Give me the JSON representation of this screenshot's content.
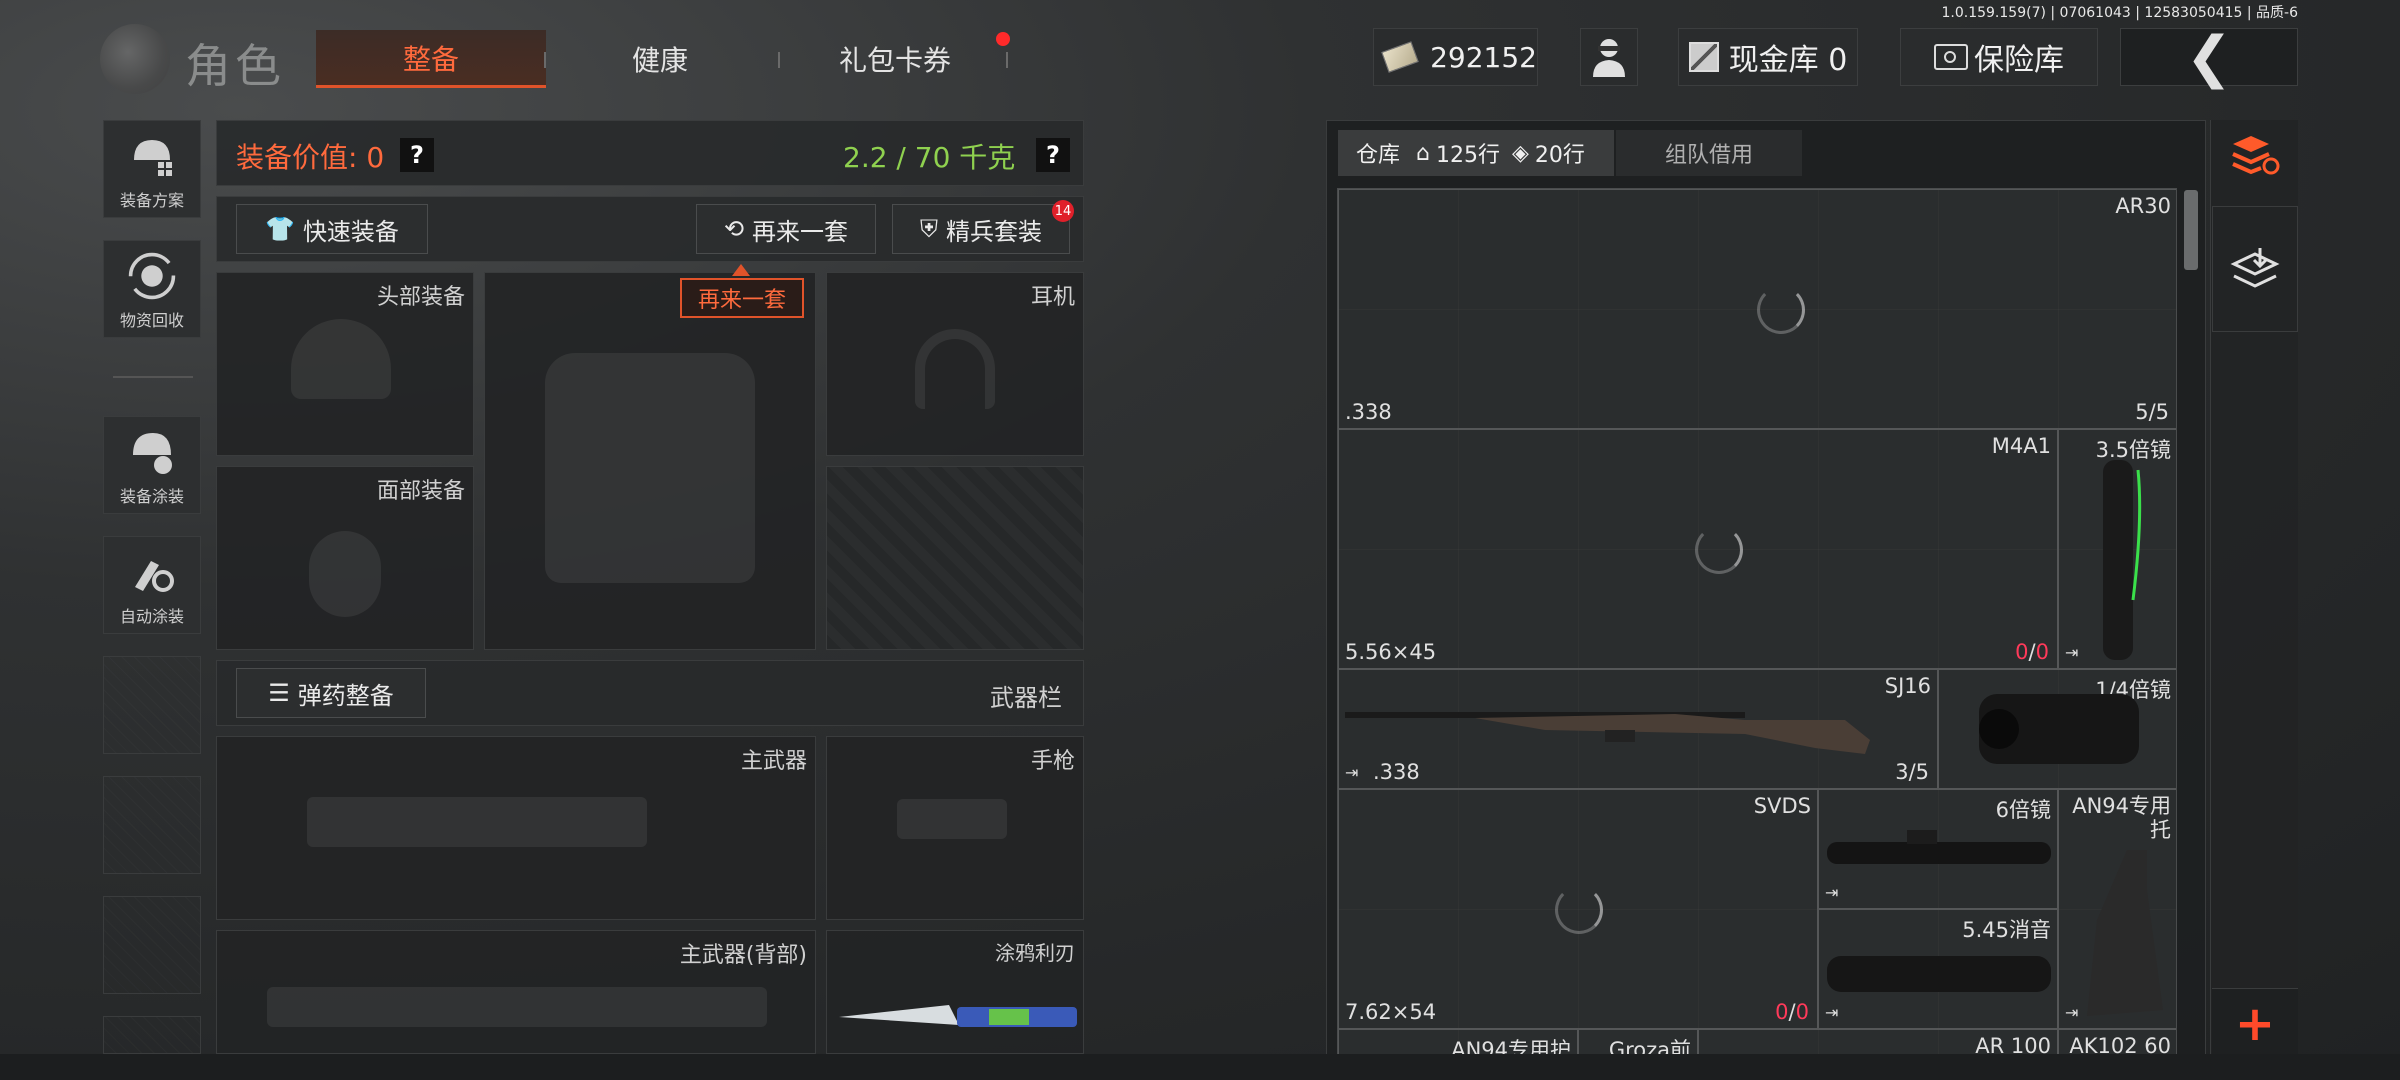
{
  "version": "1.0.159.159(7) | 07061043 | 12583050415 | 品质-6",
  "header": {
    "title": "角色",
    "tabs": [
      {
        "label": "整备",
        "active": true
      },
      {
        "label": "健康",
        "active": false
      },
      {
        "label": "礼包卡券",
        "active": false,
        "has_dot": true
      }
    ],
    "money": "292152",
    "cash_vault": "现金库 0",
    "safe_vault": "保险库"
  },
  "sidebar": {
    "items": [
      {
        "label": "装备方案",
        "icon": "helmet-plan-icon"
      },
      {
        "label": "物资回收",
        "icon": "recycle-icon"
      },
      {
        "label": "装备涂装",
        "icon": "helmet-paint-icon"
      },
      {
        "label": "自动涂装",
        "icon": "auto-paint-icon"
      }
    ]
  },
  "equipment": {
    "value_label": "装备价值: 0",
    "weight": "2.2 / 70 千克",
    "quick_equip": "快速装备",
    "again": "再来一套",
    "elite": "精兵套装",
    "elite_badge": "14",
    "tooltip": "再来一套",
    "slots": {
      "head": "头部装备",
      "headset": "耳机",
      "face": "面部装备",
      "ammo": "弹药整备",
      "weapon_bar": "武器栏",
      "primary": "主武器",
      "pistol": "手枪",
      "primary_back": "主武器(背部)",
      "knife": "涂鸦利刃"
    },
    "question_mark": "?"
  },
  "warehouse": {
    "tab_warehouse": "仓库",
    "rows_house": "125行",
    "rows_bag": "20行",
    "tab_team": "组队借用",
    "items": [
      {
        "name": "AR30",
        "cal": ".338",
        "count": "5/5"
      },
      {
        "name": "M4A1",
        "cal": "5.56×45",
        "count_a": "0",
        "count_b": "0"
      },
      {
        "name": "3.5倍镜"
      },
      {
        "name": "SJ16",
        "cal": ".338",
        "count": "3/5"
      },
      {
        "name": "1/4倍镜"
      },
      {
        "name": "SVDS",
        "cal": "7.62×54",
        "count_a": "0",
        "count_b": "0"
      },
      {
        "name": "6倍镜"
      },
      {
        "name": "AN94专用\n托"
      },
      {
        "name": "5.45消音"
      },
      {
        "name": "AN94专用护"
      },
      {
        "name": "Groza前"
      },
      {
        "name": "AR 100"
      },
      {
        "name": "AK102 60"
      }
    ]
  },
  "colors": {
    "accent": "#ff6a3d",
    "weight_green": "#8fd14f",
    "badge_red": "#e0202a",
    "plus_red": "#ff4a2a"
  }
}
